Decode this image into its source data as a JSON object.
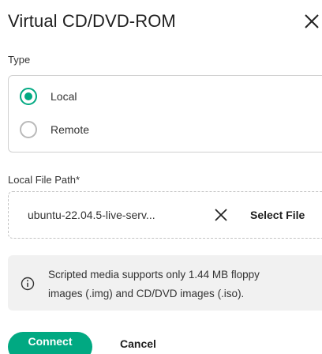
{
  "dialog": {
    "title": "Virtual CD/DVD-ROM"
  },
  "type_section": {
    "label": "Type",
    "options": [
      {
        "label": "Local",
        "selected": true
      },
      {
        "label": "Remote",
        "selected": false
      }
    ]
  },
  "file_section": {
    "label": "Local File Path*",
    "value": "ubuntu-22.04.5-live-serv...",
    "select_label": "Select File"
  },
  "info": {
    "line1": "Scripted media supports only 1.44 MB floppy",
    "line2": "images (.img) and CD/DVD images (.iso)."
  },
  "actions": {
    "connect_label": "Connect",
    "cancel_label": "Cancel"
  },
  "colors": {
    "accent": "#01a982",
    "info_background": "#f1f1f1",
    "border": "#d0d0d0"
  },
  "icons": {
    "close": "close-icon",
    "clear": "clear-icon",
    "info": "info-icon"
  }
}
